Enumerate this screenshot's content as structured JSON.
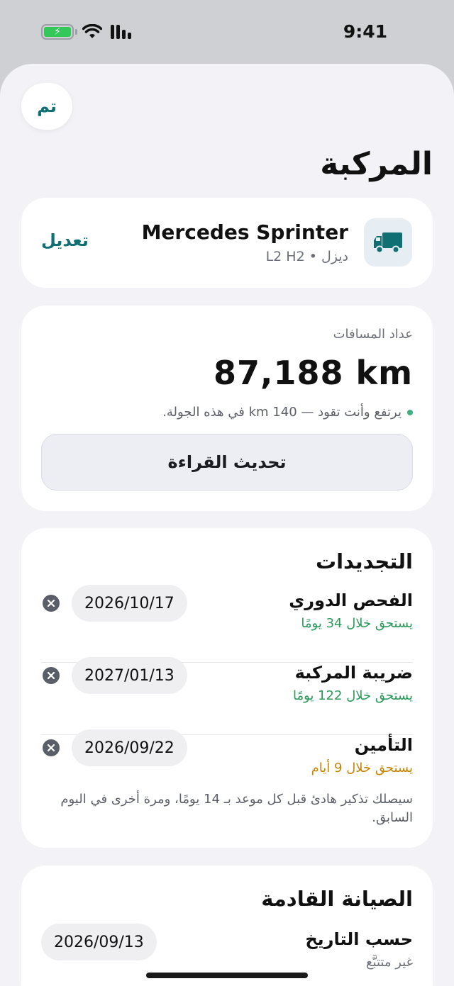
{
  "status_bar": {
    "time": "9:41"
  },
  "header": {
    "done_label": "تم",
    "title": "المركبة"
  },
  "vehicle": {
    "name": "Mercedes Sprinter",
    "subtitle": "ديزل • L2 H2",
    "edit_label": "تعديل",
    "icon": "truck-icon"
  },
  "odometer": {
    "label": "عداد المسافات",
    "value": "87,188 km",
    "note": "يرتفع وأنت تقود — 140 km في هذه الجولة.",
    "update_label": "تحديث القراءة"
  },
  "renewals": {
    "title": "التجديدات",
    "items": [
      {
        "title": "الفحص الدوري",
        "due": "يستحق خلال 34 يومًا",
        "date": "2026/10/17",
        "status": "green"
      },
      {
        "title": "ضريبة المركبة",
        "due": "يستحق خلال 122 يومًا",
        "date": "2027/01/13",
        "status": "green"
      },
      {
        "title": "التأمين",
        "due": "يستحق خلال 9 أيام",
        "date": "2026/09/22",
        "status": "orange"
      }
    ],
    "reminder": "سيصلك تذكير هادئ قبل كل موعد بـ 14 يومًا، ومرة أخرى في اليوم السابق."
  },
  "maintenance": {
    "title": "الصيانة القادمة",
    "items": [
      {
        "title": "حسب التاريخ",
        "sub": "غير متتبَّع",
        "date": "2026/09/13"
      }
    ]
  },
  "colors": {
    "accent": "#0f6f72",
    "green": "#2a9a5b",
    "orange": "#c98300"
  }
}
